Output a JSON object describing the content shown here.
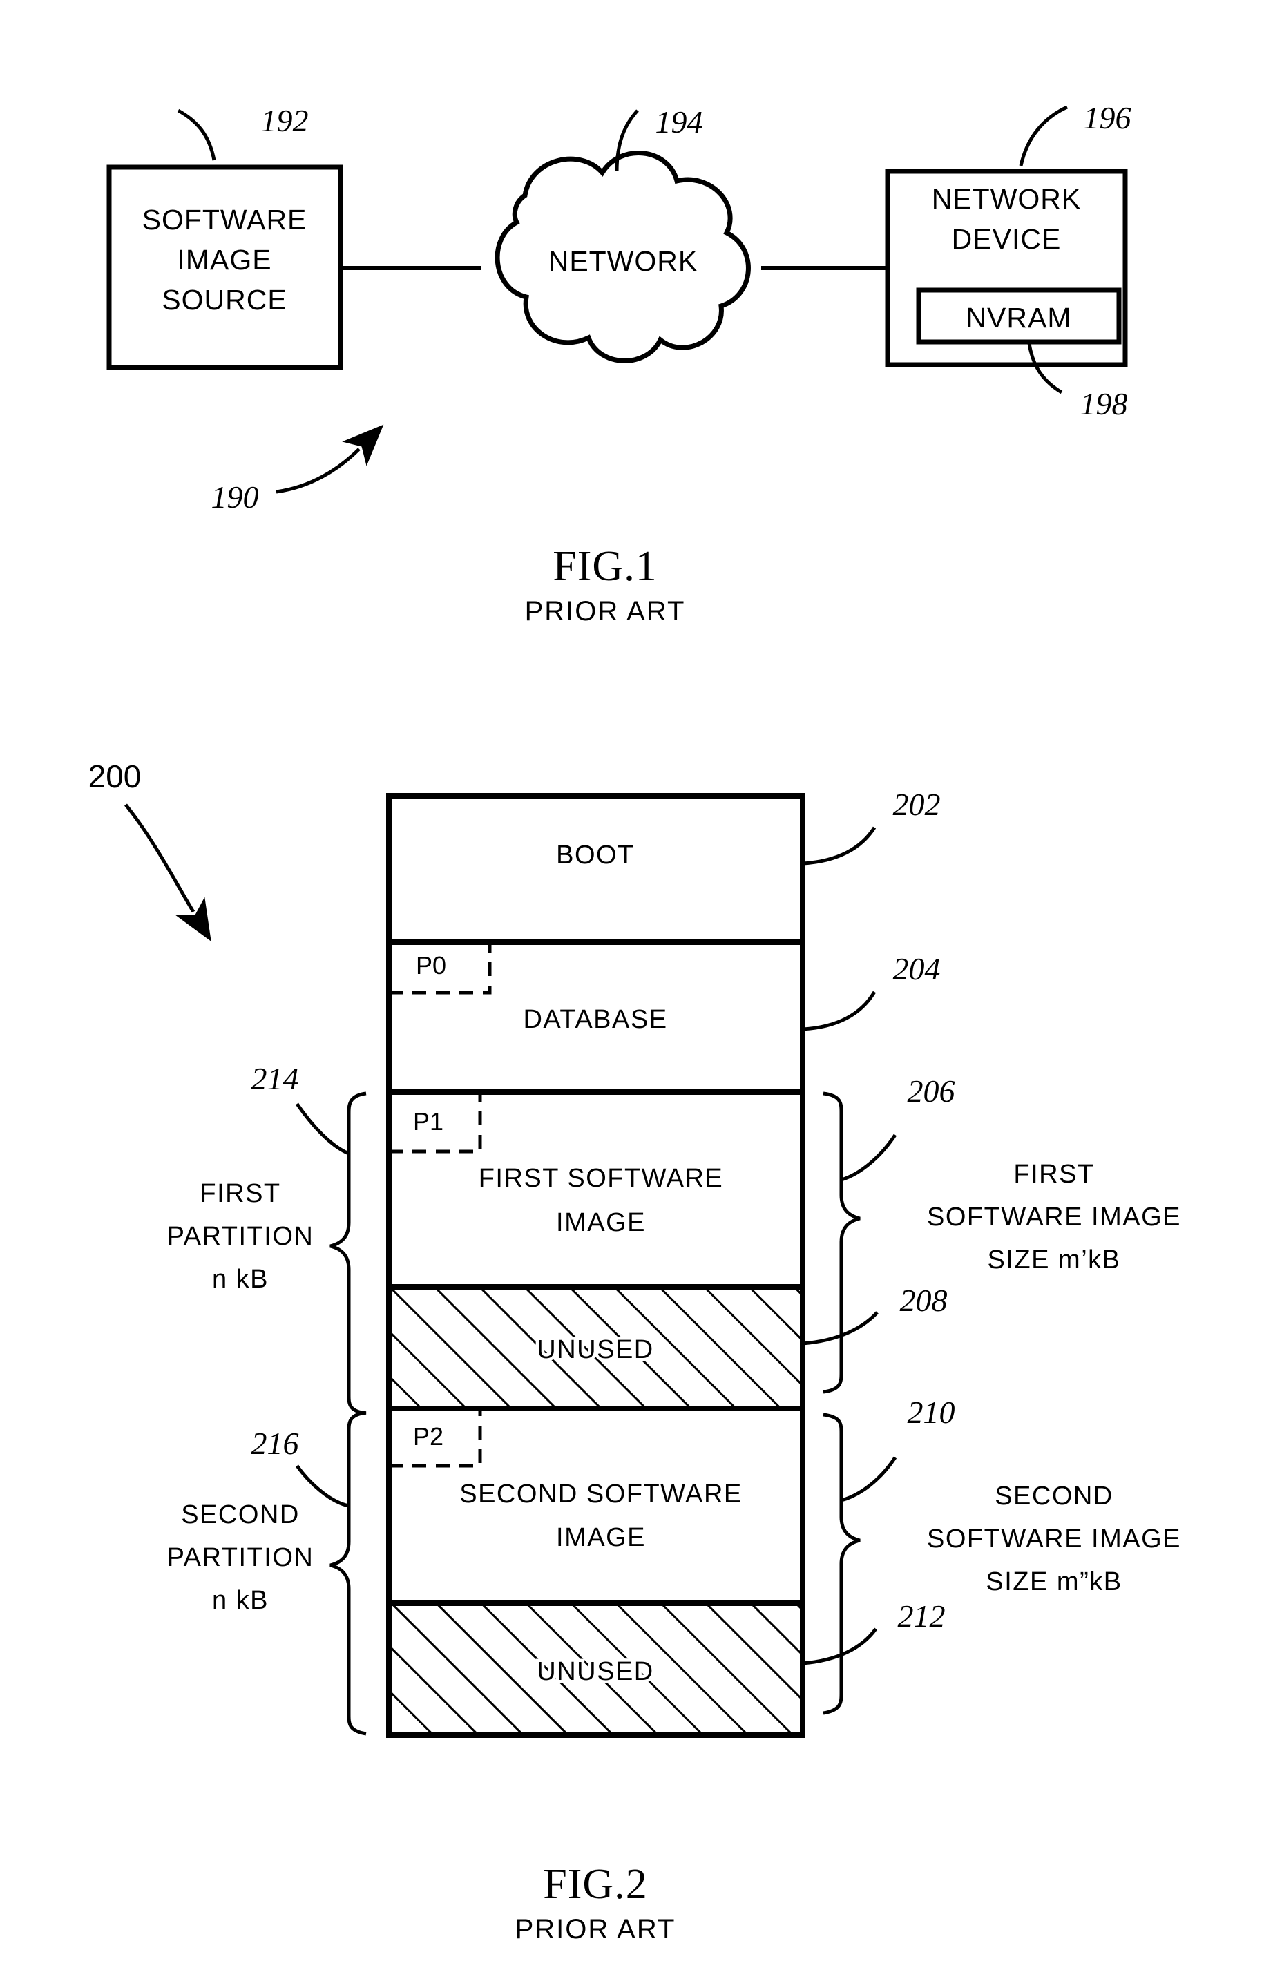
{
  "figure1": {
    "ref": "190",
    "caption": "FIG.1",
    "caption_sub": "PRIOR ART",
    "nodes": [
      {
        "ref": "192",
        "label_lines": [
          "SOFTWARE",
          "IMAGE",
          "SOURCE"
        ],
        "shape": "rect"
      },
      {
        "ref": "194",
        "label_lines": [
          "NETWORK"
        ],
        "shape": "cloud"
      },
      {
        "ref": "196",
        "label_lines": [
          "NETWORK",
          "DEVICE"
        ],
        "shape": "rect"
      }
    ],
    "inner": {
      "ref": "198",
      "label": "NVRAM"
    }
  },
  "figure2": {
    "ref": "200",
    "caption": "FIG.2",
    "caption_sub": "PRIOR ART",
    "segments": [
      {
        "ref": "202",
        "label": "BOOT",
        "tag": "",
        "hatched": false
      },
      {
        "ref": "204",
        "label": "DATABASE",
        "tag": "P0",
        "hatched": false
      },
      {
        "ref": "206",
        "label_lines": [
          "FIRST  SOFTWARE",
          "IMAGE"
        ],
        "tag": "P1",
        "hatched": false
      },
      {
        "ref": "208",
        "label": "UNUSED",
        "tag": "",
        "hatched": true
      },
      {
        "ref": "210",
        "label_lines": [
          "SECOND  SOFTWARE",
          "IMAGE"
        ],
        "tag": "P2",
        "hatched": false
      },
      {
        "ref": "212",
        "label": "UNUSED",
        "tag": "",
        "hatched": true
      }
    ],
    "left_braces": [
      {
        "ref": "214",
        "lines": [
          "FIRST",
          "PARTITION",
          "n  kB"
        ]
      },
      {
        "ref": "216",
        "lines": [
          "SECOND",
          "PARTITION",
          "n  kB"
        ]
      }
    ],
    "right_braces": [
      {
        "ref": "206",
        "lines": [
          "FIRST",
          "SOFTWARE  IMAGE",
          "SIZE  m’kB"
        ]
      },
      {
        "ref": "210",
        "lines": [
          "SECOND",
          "SOFTWARE  IMAGE",
          "SIZE  m”kB"
        ]
      }
    ]
  }
}
